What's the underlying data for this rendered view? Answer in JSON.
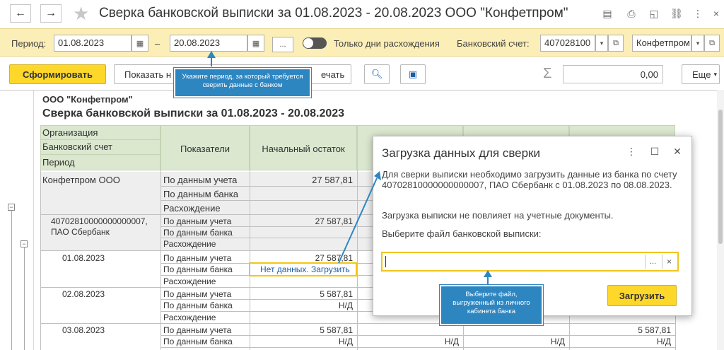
{
  "window": {
    "title": "Сверка банковской выписки за 01.08.2023 - 20.08.2023 ООО \"Конфетпром\""
  },
  "period_bar": {
    "period_label": "Период:",
    "date_from": "01.08.2023",
    "dash": "–",
    "date_to": "20.08.2023",
    "more_btn": "...",
    "only_diff_label": "Только дни расхождения",
    "bank_account_label": "Банковский счет:",
    "bank_account_value": "407028100",
    "org_value": "Конфетпром"
  },
  "toolbar": {
    "generate_label": "Сформировать",
    "show_label": "Показать н",
    "print_label": "ечать",
    "sum_value": "0,00",
    "more_label": "Еще"
  },
  "report": {
    "org_name": "ООО \"Конфетпром\"",
    "title": "Сверка банковской выписки  за 01.08.2023 - 20.08.2023",
    "header": {
      "col1_rows": [
        "Организация",
        "Банковский счет",
        "Период"
      ],
      "indicators": "Показатели",
      "opening_balance": "Начальный остаток"
    },
    "groups": [
      {
        "name": "Конфетпром ООО",
        "rows": [
          {
            "label": "По данным учета",
            "value": "27 587,81"
          },
          {
            "label": "По данным банка",
            "value": ""
          },
          {
            "label": "Расхождение",
            "value": ""
          }
        ]
      },
      {
        "name": "40702810000000000007, ПАО Сбербанк",
        "rows": [
          {
            "label": "По данным учета",
            "value": "27 587,81"
          },
          {
            "label": "По данным банка",
            "value": ""
          },
          {
            "label": "Расхождение",
            "value": ""
          }
        ]
      },
      {
        "name": "01.08.2023",
        "rows": [
          {
            "label": "По данным учета",
            "value": "27 587,81"
          },
          {
            "label": "По данным банка",
            "value": "Нет данных. Загрузить"
          },
          {
            "label": "Расхождение",
            "value": ""
          }
        ]
      },
      {
        "name": "02.08.2023",
        "rows": [
          {
            "label": "По данным учета",
            "value": "5 587,81"
          },
          {
            "label": "По данным банка",
            "value": "Н/Д"
          },
          {
            "label": "Расхождение",
            "value": ""
          }
        ]
      },
      {
        "name": "03.08.2023",
        "rows": [
          {
            "label": "По данным учета",
            "value": "5 587,81",
            "last": "5 587,81"
          },
          {
            "label": "По данным банка",
            "value": "Н/Д",
            "c2": "Н/Д",
            "c3": "Н/Д",
            "last": "Н/Д"
          }
        ]
      }
    ]
  },
  "dialog": {
    "title": "Загрузка данных для сверки",
    "text1": "Для сверки выписки необходимо загрузить данные из банка по счету 40702810000000000007, ПАО Сбербанк с 01.08.2023 по 08.08.2023.",
    "text2": "Загрузка выписки не повлияет на учетные документы.",
    "text3": "Выберите файл банковской выписки:",
    "more_btn": "...",
    "clear_btn": "×",
    "load_btn": "Загрузить"
  },
  "callouts": {
    "period_hint": "Укажите период, за который требуется сверить данные с банком",
    "file_hint": "Выберите файл, выгруженный из личного кабинета банка"
  },
  "colors": {
    "accent_yellow": "#fdd72a",
    "period_bar_bg": "#fbeeb6",
    "header_green": "#dbe7cf",
    "callout_blue": "#2e86c1",
    "link_blue": "#1a5ea8"
  }
}
